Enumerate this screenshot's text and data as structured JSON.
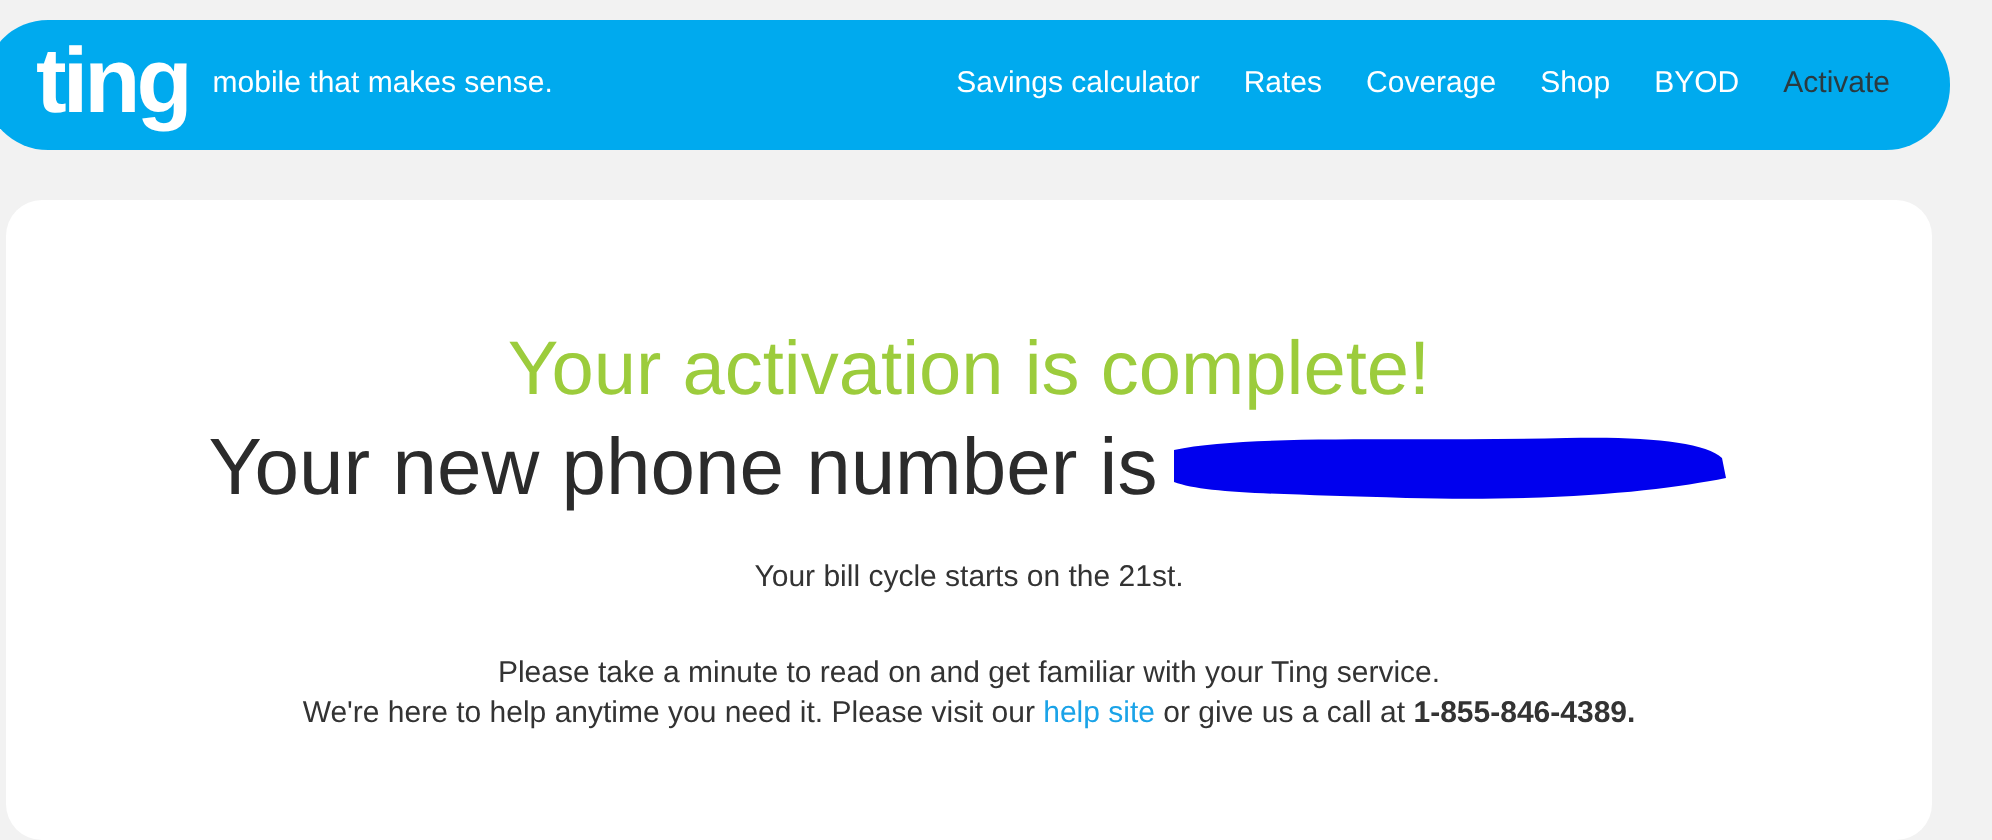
{
  "header": {
    "logo": "ting",
    "tagline": "mobile that makes sense.",
    "nav": [
      {
        "label": "Savings calculator",
        "selected": false
      },
      {
        "label": "Rates",
        "selected": false
      },
      {
        "label": "Coverage",
        "selected": false
      },
      {
        "label": "Shop",
        "selected": false
      },
      {
        "label": "BYOD",
        "selected": false
      },
      {
        "label": "Activate",
        "selected": true
      }
    ]
  },
  "content": {
    "heading": "Your activation is complete!",
    "phone_line": "Your new phone number is",
    "bill_cycle": "Your bill cycle starts on the 21st.",
    "intro": "Please take a minute to read on and get familiar with your Ting service.",
    "help_before": "We're here to help anytime you need it. Please visit our",
    "help_link": "help site",
    "help_middle": "or give us a call at",
    "help_phone": "1-855-846-4389."
  }
}
